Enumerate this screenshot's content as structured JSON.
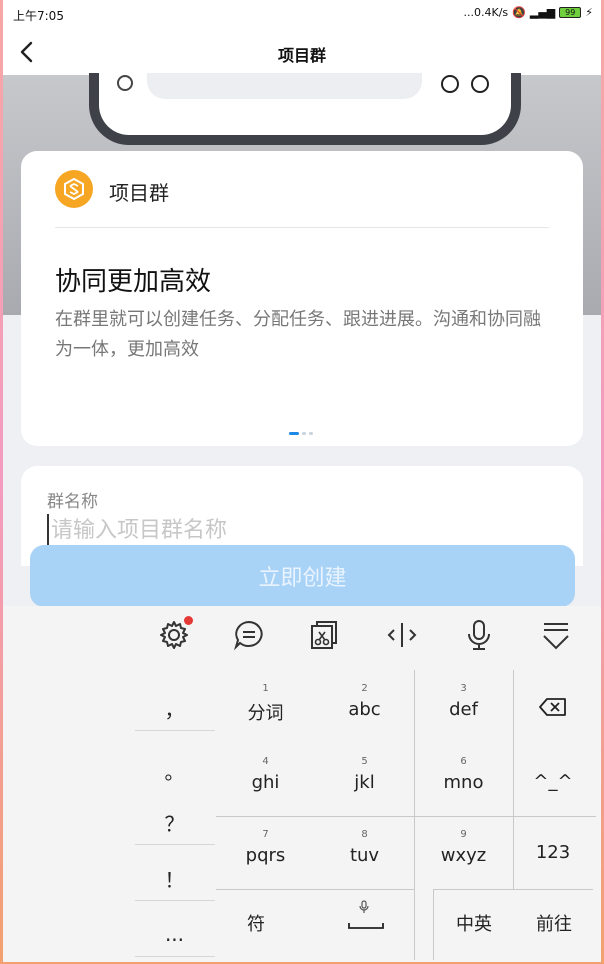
{
  "status_bar": {
    "time": "上午7:05",
    "speed": "...0.4K/s",
    "battery": "99"
  },
  "nav": {
    "title": "项目群"
  },
  "card": {
    "name": "项目群",
    "headline": "协同更加高效",
    "description": "在群里就可以创建任务、分配任务、跟进进展。沟通和协同融为一体，更加高效"
  },
  "form": {
    "label": "群名称",
    "placeholder": "请输入项目群名称"
  },
  "button": {
    "create": "立即创建"
  },
  "keyboard": {
    "toolbar": [
      "gear-icon",
      "chat-icon",
      "clipboard-icon",
      "cursor-icon",
      "mic-icon",
      "collapse-icon"
    ],
    "punctuation": [
      "，",
      "。",
      "？",
      "！",
      "..."
    ],
    "keys": [
      {
        "num": "1",
        "label": "分词"
      },
      {
        "num": "2",
        "label": "abc"
      },
      {
        "num": "3",
        "label": "def"
      },
      {
        "num": "4",
        "label": "ghi"
      },
      {
        "num": "5",
        "label": "jkl"
      },
      {
        "num": "6",
        "label": "mno"
      },
      {
        "num": "7",
        "label": "pqrs"
      },
      {
        "num": "8",
        "label": "tuv"
      },
      {
        "num": "9",
        "label": "wxyz"
      }
    ],
    "emoticon": "^_^",
    "numbers": "123",
    "symbol": "符",
    "lang": "中英",
    "go": "前往"
  },
  "colors": {
    "accent": "#1e88e5",
    "button_disabled": "#a9d2f7",
    "logo": "#f6a623"
  }
}
